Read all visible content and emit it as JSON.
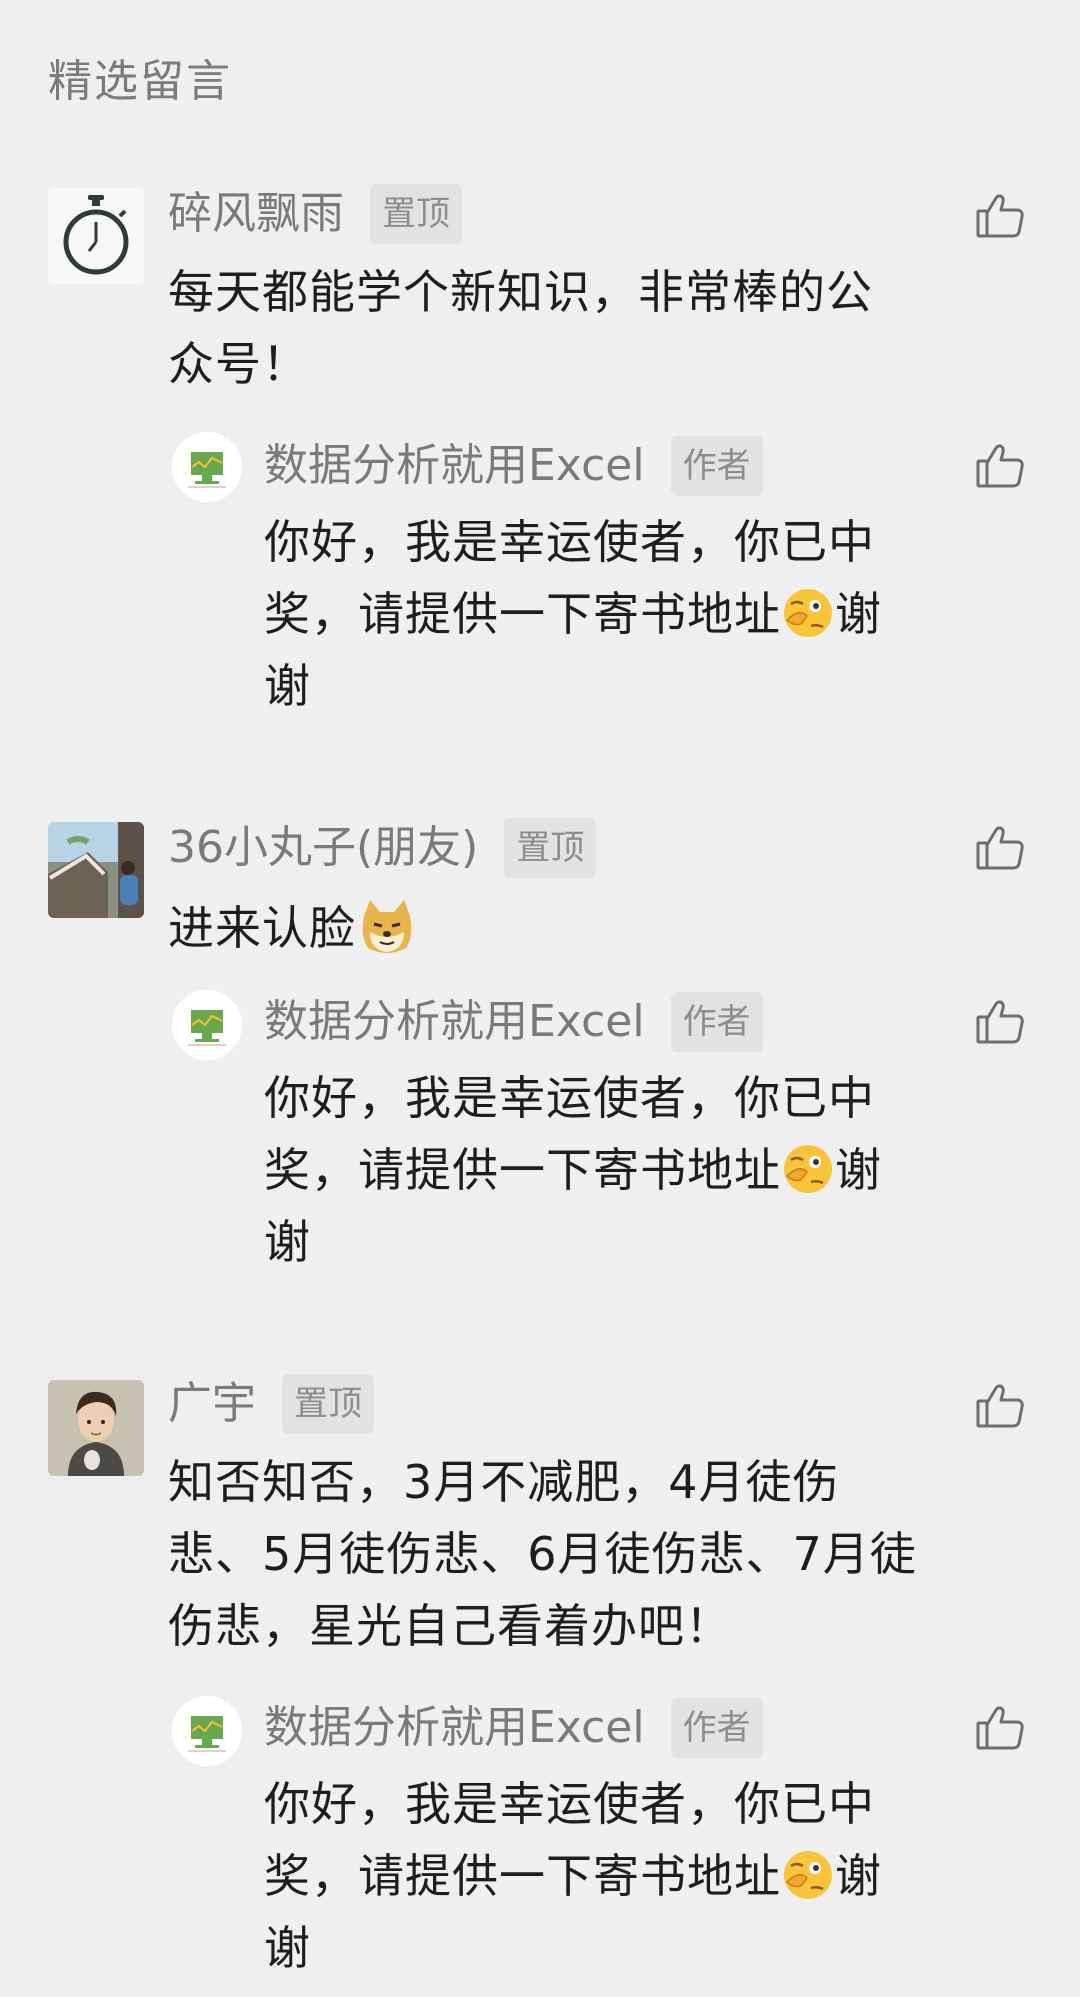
{
  "section_title": "精选留言",
  "comments": [
    {
      "user": "碎风飘雨",
      "badge": "置顶",
      "text_lines": [
        "每天都能学个新知识，非常棒的公",
        "众号！"
      ],
      "avatar_icon": "stopwatch-icon",
      "reply": {
        "user": "数据分析就用Excel",
        "badge": "作者",
        "text_lines": [
          "你好，我是幸运使者，你已中",
          "奖，请提供一下寄书地址",
          "谢",
          "谢"
        ],
        "emoji": "thinking-face-emoji"
      }
    },
    {
      "user": "36小丸子(朋友)",
      "badge": "置顶",
      "text": "进来认脸",
      "emoji": "doge-emoji",
      "avatar_icon": "photo-avatar-icon",
      "reply": {
        "user": "数据分析就用Excel",
        "badge": "作者",
        "text_lines": [
          "你好，我是幸运使者，你已中",
          "奖，请提供一下寄书地址",
          "谢",
          "谢"
        ],
        "emoji": "thinking-face-emoji"
      }
    },
    {
      "user": "广宇",
      "badge": "置顶",
      "text_lines": [
        "知否知否，3月不减肥，4月徒伤",
        "悲、5月徒伤悲、6月徒伤悲、7月徒",
        "伤悲，星光自己看着办吧！"
      ],
      "avatar_icon": "illustrated-boy-avatar-icon",
      "reply": {
        "user": "数据分析就用Excel",
        "badge": "作者",
        "text_lines": [
          "你好，我是幸运使者，你已中",
          "奖，请提供一下寄书地址",
          "谢",
          "谢"
        ],
        "emoji": "thinking-face-emoji"
      }
    }
  ],
  "colors": {
    "background": "#efefef",
    "name": "#7a7a7a",
    "badge_bg": "#e2e2e2",
    "text": "#1e1e1e",
    "like_icon": "#6e6e6e"
  }
}
